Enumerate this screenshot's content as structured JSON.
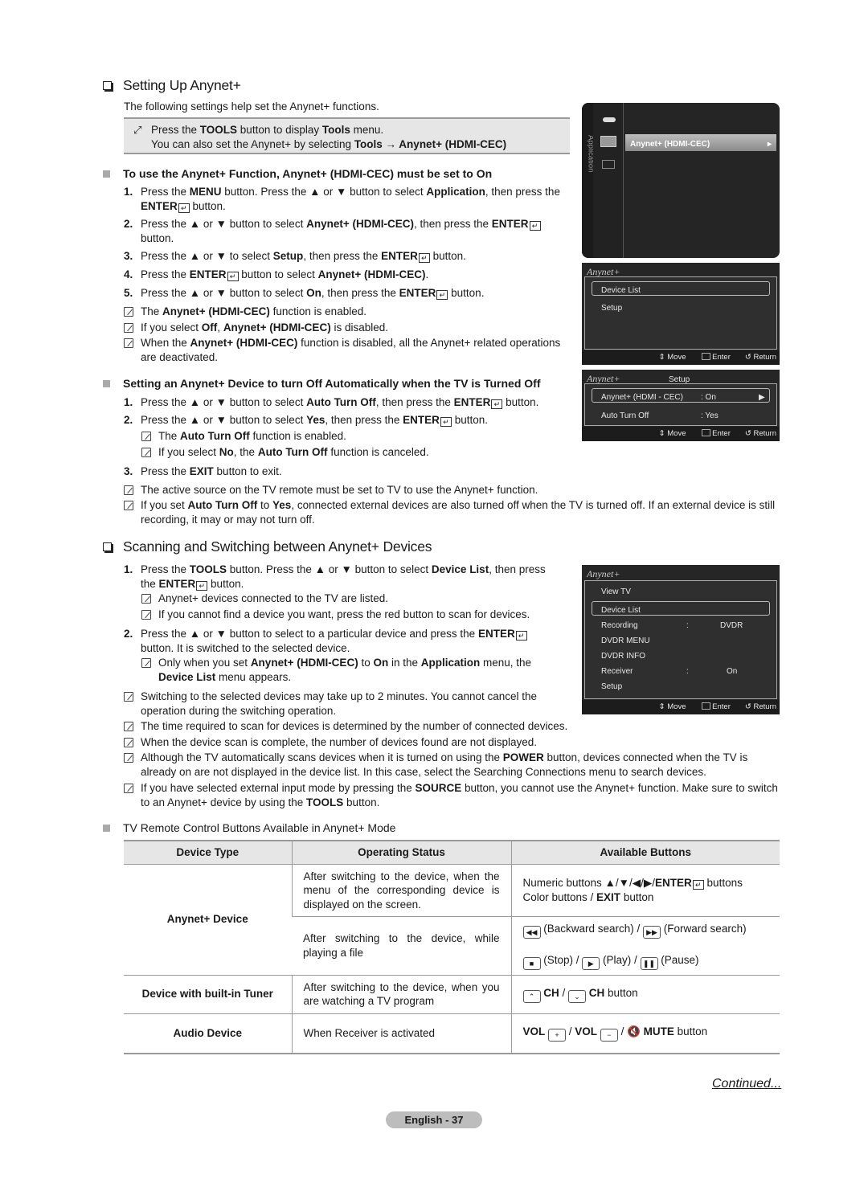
{
  "section1": {
    "title": "Setting Up Anynet+",
    "intro": "The following settings help set the Anynet+ functions.",
    "tools_box": {
      "icon": "tools-icon",
      "line1_a": "Press the ",
      "line1_b": "TOOLS",
      "line1_c": " button to display ",
      "line1_d": "Tools",
      "line1_e": " menu.",
      "line2_a": "You can also set the Anynet+ by selecting ",
      "line2_b": "Tools → Anynet+ (HDMI-CEC)"
    },
    "sub1": {
      "title": "To use the Anynet+ Function, Anynet+ (HDMI-CEC) must be set to On",
      "steps": [
        {
          "n": "1.",
          "html": "Press the <b>MENU</b> button. Press the ▲ or ▼ button to select <b>Application</b>, then press the <b>ENTER</b>⏎ button."
        },
        {
          "n": "2.",
          "html": "Press the ▲ or ▼ button to select <b>Anynet+ (HDMI-CEC)</b>, then press the <b>ENTER</b>⏎ button."
        },
        {
          "n": "3.",
          "html": "Press the  ▲ or ▼  to select <b>Setup</b>, then press the <b>ENTER</b>⏎ button."
        },
        {
          "n": "4.",
          "html": "Press the <b>ENTER</b>⏎ button to select <b>Anynet+ (HDMI-CEC)</b>."
        },
        {
          "n": "5.",
          "html": "Press the ▲ or ▼ button to select <b>On</b>, then press the <b>ENTER</b>⏎ button."
        }
      ],
      "notes": [
        "The <b>Anynet+ (HDMI-CEC)</b> function is enabled.",
        "If you select <b>Off</b>, <b>Anynet+ (HDMI-CEC)</b> is disabled.",
        "When the <b>Anynet+ (HDMI-CEC)</b> function is disabled, all the Anynet+ related operations are deactivated."
      ]
    },
    "sub2": {
      "title": "Setting an Anynet+ Device to turn Off Automatically when the TV is Turned Off",
      "steps": [
        {
          "n": "1.",
          "html": "Press the ▲ or ▼ button to select <b>Auto Turn Off</b>, then press the <b>ENTER</b>⏎ button."
        },
        {
          "n": "2.",
          "html": "Press the ▲ or ▼ button to select <b>Yes</b>, then press the <b>ENTER</b>⏎ button."
        },
        {
          "n": "3.",
          "html": "Press the <b>EXIT</b> button to exit."
        }
      ],
      "step2_notes": [
        "The <b>Auto Turn Off</b> function is enabled.",
        "If you select <b>No</b>, the <b>Auto Turn Off</b> function is canceled."
      ],
      "notes": [
        "The active source on the TV remote must be set to TV to use the Anynet+ function.",
        "If you set <b>Auto Turn Off</b> to <b>Yes</b>, connected external devices are also turned off when the TV is turned off. If an external device is still recording, it may or may not turn off."
      ]
    }
  },
  "osd_application": {
    "tab_label": "Application",
    "highlight": "Anynet+ (HDMI-CEC)",
    "arrow": "▸"
  },
  "osd_anynet_main": {
    "logo": "Anynet+",
    "items": [
      "Device List",
      "Setup"
    ],
    "footer": {
      "move": "⇕ Move",
      "enter": "Enter",
      "return": "↺ Return"
    }
  },
  "osd_setup": {
    "logo": "Anynet+",
    "title": "Setup",
    "rows": [
      {
        "label": "Anynet+ (HDMI - CEC)",
        "value": ": On",
        "arrow": "▶"
      },
      {
        "label": "Auto Turn Off",
        "value": ": Yes"
      }
    ],
    "footer": {
      "move": "⇕ Move",
      "enter": "Enter",
      "return": "↺ Return"
    }
  },
  "osd_device_list": {
    "logo": "Anynet+",
    "items": [
      {
        "label": "View TV"
      },
      {
        "label": "Device List",
        "selected": true
      },
      {
        "label": "Recording",
        "sep": ":",
        "value": "DVDR"
      },
      {
        "label": "DVDR MENU"
      },
      {
        "label": "DVDR INFO"
      },
      {
        "label": "Receiver",
        "sep": ":",
        "value": "On"
      },
      {
        "label": "Setup"
      }
    ],
    "footer": {
      "move": "⇕ Move",
      "enter": "Enter",
      "return": "↺ Return"
    }
  },
  "section2": {
    "title": "Scanning and Switching between Anynet+ Devices",
    "step1": {
      "n": "1.",
      "html": "Press the <b>TOOLS</b> button. Press the ▲ or ▼ button to select <b>Device List</b>, then press the <b>ENTER</b>⏎ button."
    },
    "step1_notes": [
      "Anynet+ devices connected to the TV are listed.",
      "If you cannot find a device you want, press the red button to scan for devices."
    ],
    "step2": {
      "n": "2.",
      "html": "Press the ▲ or ▼ button to select to a particular device and press the <b>ENTER</b>⏎ button. It is switched to the selected device."
    },
    "step2_notes": [
      "Only when you set <b>Anynet+ (HDMI-CEC)</b> to <b>On</b> in the <b>Application</b> menu, the <b>Device List</b> menu appears."
    ],
    "notes": [
      "Switching to the selected devices may take up to 2 minutes. You cannot cancel the operation during the switching operation.",
      "The time required to scan for devices is determined by the number of connected devices.",
      "When the device scan is complete, the number of devices found are not displayed.",
      "Although the TV automatically scans devices when it is turned on using the <b>POWER</b> button, devices connected when the TV is already on are not displayed in the device list. In this case, select the Searching Connections menu to search devices.",
      "If you have selected external input mode by pressing the <b>SOURCE</b> button, you cannot use the Anynet+ function. Make sure to switch to an Anynet+ device by using the <b>TOOLS</b> button."
    ],
    "sub_title": "TV Remote Control Buttons Available in Anynet+ Mode"
  },
  "table": {
    "headers": [
      "Device Type",
      "Operating Status",
      "Available Buttons"
    ],
    "rows": [
      {
        "type": "Anynet+ Device",
        "status": "After switching to the device, when the menu of the corresponding device is displayed on the screen.",
        "buttons": "Numeric buttons ▲/▼/◀/▶/<b>ENTER</b>⏎ buttons<br>Color buttons / <b>EXIT</b> button"
      },
      {
        "status": "After switching to the device, while playing a file",
        "buttons": "<span class='key'>◀◀</span> (Backward search) / <span class='key'>▶▶</span> (Forward search)<br><span style='display:inline-block;height:10px'></span><br><span class='key'>■</span> (Stop) / <span class='key'>▶</span> (Play) / <span class='key'>❚❚</span> (Pause)"
      },
      {
        "type": "Device with built-in Tuner",
        "status": "After switching to the device, when you are watching a TV program",
        "buttons": "<span class='key'>⌃</span> <b>CH</b> / <span class='key'>⌄</span> <b>CH</b> button"
      },
      {
        "type": "Audio Device",
        "status": "When Receiver is activated",
        "buttons": "<b>VOL</b> <span class='key'>+</span> / <b>VOL</b> <span class='key'>−</span> / 🔇 <b>MUTE</b> button"
      }
    ]
  },
  "footer": {
    "continued": "Continued...",
    "page": "English - 37"
  }
}
